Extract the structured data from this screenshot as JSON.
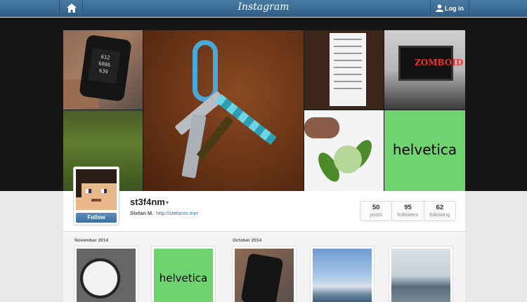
{
  "topbar": {
    "logo": "Instagram",
    "login_label": "Log in"
  },
  "hero": {
    "watch_screen": [
      "612",
      "6086",
      "639"
    ],
    "monitor_text": "ZOMBOID",
    "helvetica_tile": "helvetica"
  },
  "profile": {
    "username": "st3f4nm",
    "full_name": "Stefan M.",
    "website": "http://stefanm.me/",
    "follow_label": "Follow",
    "stats": [
      {
        "num": "50",
        "label": "posts"
      },
      {
        "num": "95",
        "label": "followers"
      },
      {
        "num": "62",
        "label": "following"
      }
    ]
  },
  "feed": {
    "month_1": "November 2014",
    "month_2": "October 2014",
    "helvetica_thumb": "helvetica"
  },
  "icons": {
    "home": "home-icon",
    "user": "user-icon",
    "chevron": "chevron-down-icon"
  }
}
